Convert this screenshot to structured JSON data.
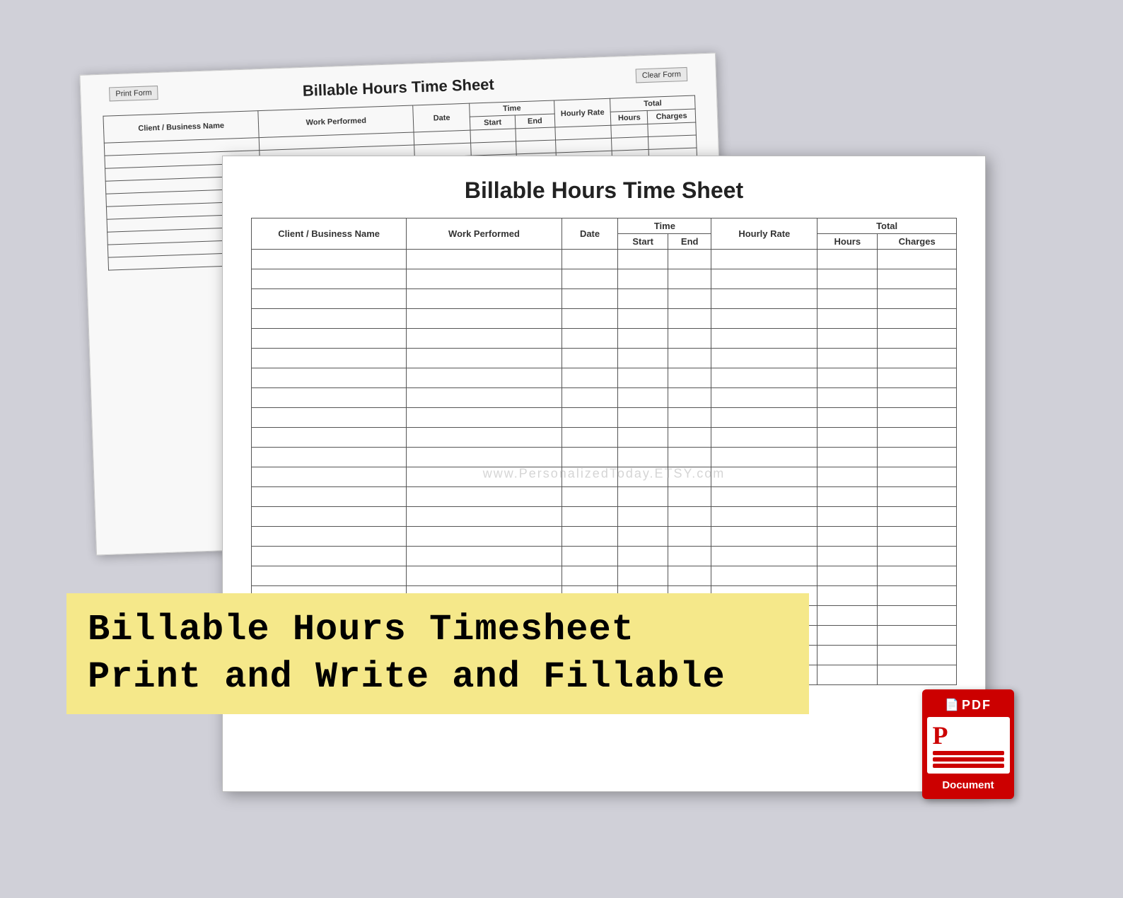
{
  "back_sheet": {
    "title": "Billable Hours Time Sheet",
    "btn_print": "Print Form",
    "btn_clear": "Clear Form",
    "headers": {
      "client": "Client / Business Name",
      "work": "Work Performed",
      "date": "Date",
      "time_group": "Time",
      "time_start": "Start",
      "time_end": "End",
      "hourly": "Hourly Rate",
      "total_group": "Total",
      "total_hours": "Hours",
      "total_charges": "Charges"
    },
    "num_rows": 10
  },
  "front_sheet": {
    "title": "Billable Hours Time Sheet",
    "headers": {
      "client": "Client / Business Name",
      "work": "Work Performed",
      "date": "Date",
      "time_group": "Time",
      "time_start": "Start",
      "time_end": "End",
      "hourly": "Hourly Rate",
      "total_group": "Total",
      "total_hours": "Hours",
      "total_charges": "Charges"
    },
    "num_rows": 22
  },
  "watermark": "www.PersonalizedToday.ETSY.com",
  "banner": {
    "line1": "Billable Hours Timesheet",
    "line2": "Print and Write and Fillable"
  },
  "pdf_icon": {
    "top_label": "PDF",
    "bottom_label": "Document"
  }
}
